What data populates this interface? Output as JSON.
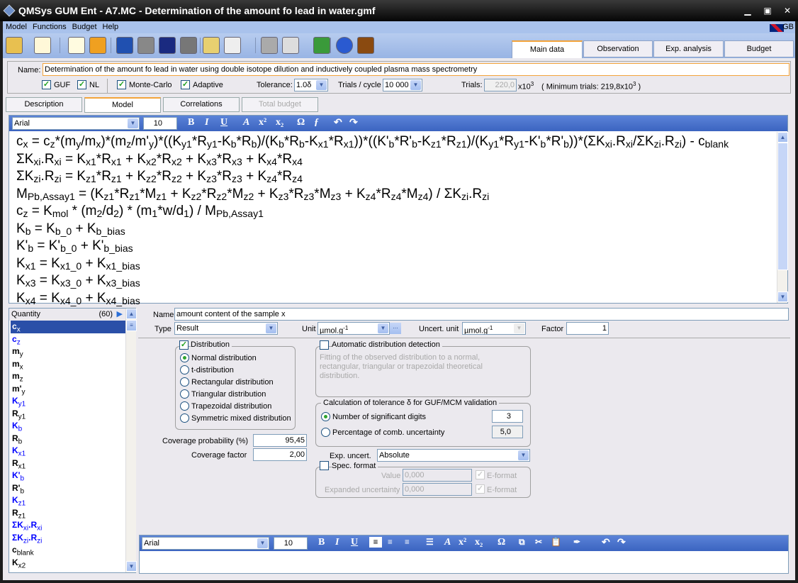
{
  "window": {
    "title": "QMSys GUM Ent - A7.MC - Determination of the amount fo lead in water.gmf",
    "lang": "GB"
  },
  "menu": [
    "Model",
    "Functions",
    "Budget",
    "Help"
  ],
  "toolbar_icons": [
    "open-folder-icon",
    "new-file-icon",
    "recalculate-icon",
    "monte-carlo-icon",
    "delete-icon",
    "save-icon",
    "save-as-icon",
    "close-icon",
    "settings-icon",
    "copy-icon",
    "calculator-icon",
    "print-icon",
    "export-excel-icon",
    "help-icon",
    "exit-icon"
  ],
  "main_tabs": [
    {
      "label": "Main data",
      "active": true
    },
    {
      "label": "Observation"
    },
    {
      "label": "Exp. analysis"
    },
    {
      "label": "Budget"
    }
  ],
  "name_row": {
    "label": "Name:",
    "value": "Determination of the amount fo lead in water using double isotope dilution and inductively coupled plasma mass spectrometry"
  },
  "options": {
    "guf": "GUF",
    "nl": "NL",
    "monte_carlo": "Monte-Carlo",
    "adaptive": "Adaptive",
    "tolerance_label": "Tolerance:",
    "tolerance": "1.0δ",
    "trials_cycle_label": "Trials / cycle",
    "trials_cycle": "10 000",
    "trials_label": "Trials:",
    "trials": "220,0",
    "trials_unit": "x10",
    "trials_exp": "3",
    "min_trials": "( Minimum trials: 219,8x10",
    "min_trials_end": ")"
  },
  "sub_tabs": [
    {
      "label": "Description"
    },
    {
      "label": "Model",
      "active": true
    },
    {
      "label": "Correlations"
    },
    {
      "label": "Total budget",
      "disabled": true
    }
  ],
  "editor": {
    "font": "Arial",
    "size": "10"
  },
  "equations": [
    "c_{x} = c_{z}*(m_{y}/m_{x})*(m_{z}/m'_{y})*((K_{y1}*R_{y1}-K_{b}*R_{b})/(K_{b}*R_{b}-K_{x1}*R_{x1}))*((K'_{b}*R'_{b}-K_{z1}*R_{z1})/(K_{y1}*R_{y1}-K'_{b}*R'_{b}))*(ΣK_{xi}.R_{xi}/ΣK_{zi}.R_{zi}) - c_{blank}",
    "ΣK_{xi}.R_{xi} = K_{x1}*R_{x1} + K_{x2}*R_{x2} + K_{x3}*R_{x3} + K_{x4}*R_{x4}",
    "ΣK_{zi}.R_{zi} = K_{z1}*R_{z1} + K_{z2}*R_{z2} + K_{z3}*R_{z3} + K_{z4}*R_{z4}",
    "M_{Pb,Assay1} = (K_{z1}*R_{z1}*M_{z1} + K_{z2}*R_{z2}*M_{z2} + K_{z3}*R_{z3}*M_{z3} + K_{z4}*R_{z4}*M_{z4}) / ΣK_{zi}.R_{zi}",
    "c_{z} = K_{mol} * (m_{2}/d_{2}) * (m_{1}*w/d_{1}) / M_{Pb,Assay1}",
    "K_{b} = K_{b_0} + K_{b_bias}",
    "K'_{b} = K'_{b_0} + K'_{b_bias}",
    "K_{x1} = K_{x1_0} + K_{x1_bias}",
    "K_{x3} = K_{x3_0} + K_{x3_bias}",
    "K_{x4} = K_{x4_0} + K_{x4_bias}"
  ],
  "quantity_list": {
    "header": "Quantity",
    "count": "(60)",
    "items": [
      {
        "t": "c_{x}",
        "c": "sel"
      },
      {
        "t": "c_{z}",
        "c": "blue"
      },
      {
        "t": "m_{y}"
      },
      {
        "t": "m_{x}"
      },
      {
        "t": "m_{z}"
      },
      {
        "t": "m'_{y}"
      },
      {
        "t": "K_{y1}",
        "c": "blue"
      },
      {
        "t": "R_{y1}"
      },
      {
        "t": "K_{b}",
        "c": "blue"
      },
      {
        "t": "R_{b}"
      },
      {
        "t": "K_{x1}",
        "c": "blue"
      },
      {
        "t": "R_{x1}"
      },
      {
        "t": "K'_{b}",
        "c": "blue"
      },
      {
        "t": "R'_{b}"
      },
      {
        "t": "K_{z1}",
        "c": "blue"
      },
      {
        "t": "R_{z1}"
      },
      {
        "t": "ΣK_{xi}.R_{xi}",
        "c": "blue"
      },
      {
        "t": "ΣK_{zi}.R_{zi}",
        "c": "blue"
      },
      {
        "t": "c_{blank}"
      },
      {
        "t": "K_{x2}"
      }
    ]
  },
  "quantity": {
    "name_label": "Name",
    "name": "amount content of the sample x",
    "type_label": "Type",
    "type": "Result",
    "unit_label": "Unit",
    "unit": "µmol.g",
    "unit_exp": "-1",
    "uncert_unit_label": "Uncert. unit",
    "uncert_unit": "µmol.g",
    "factor_label": "Factor",
    "factor": "1",
    "distribution_label": "Distribution",
    "distributions": [
      "Normal distribution",
      "t-distribution",
      "Rectangular distribution",
      "Triangular distribution",
      "Trapezoidal distribution",
      "Symmetric mixed distribution"
    ],
    "selected_distribution": 0,
    "auto_detect_label": "Automatic distribution detection",
    "auto_detect_text": [
      "Fitting of the observed distribution to a normal,",
      "rectangular, triangular or trapezoidal theoretical",
      "distribution."
    ],
    "tolerance_group": "Calculation of tolerance δ for GUF/MCM validation",
    "sig_digits_label": "Number of significant digits",
    "sig_digits": "3",
    "pct_label": "Percentage of comb. uncertainty",
    "pct": "5,0",
    "cov_prob_label": "Coverage probability (%)",
    "cov_prob": "95,45",
    "cov_factor_label": "Coverage factor",
    "cov_factor": "2,00",
    "exp_uncert_label": "Exp. uncert.",
    "exp_uncert": "Absolute",
    "spec_format_label": "Spec. format",
    "value_label": "Value",
    "value": "0,000",
    "exp_unc_label": "Expanded uncertainty",
    "exp_unc": "0,000",
    "eformat": "E-format"
  },
  "note_editor": {
    "font": "Arial",
    "size": "10"
  },
  "colors": {
    "accent_tab": "#f3a43b",
    "selection": "#2a4fa8",
    "blue_item": "#0000ff"
  }
}
